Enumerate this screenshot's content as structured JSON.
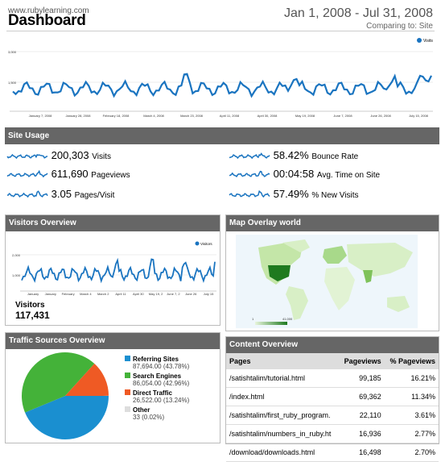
{
  "header": {
    "site": "www.rubylearning.com",
    "title": "Dashboard",
    "date_range": "Jan 1, 2008 - Jul 31, 2008",
    "comparing": "Comparing to: Site"
  },
  "main_chart": {
    "legend": "Visits",
    "y_labels": [
      "3,000",
      "1,500"
    ],
    "x_labels": [
      "January 7, 2008",
      "January 28, 2008",
      "February 18, 2008",
      "March 4, 2008",
      "March 23, 2008",
      "April 11, 2008",
      "April 30, 2008",
      "May 19, 2008",
      "June 7, 2008",
      "June 26, 2008",
      "July 15, 2008"
    ]
  },
  "site_usage": {
    "heading": "Site Usage",
    "metrics": [
      {
        "value": "200,303",
        "label": "Visits"
      },
      {
        "value": "58.42%",
        "label": "Bounce Rate"
      },
      {
        "value": "611,690",
        "label": "Pageviews"
      },
      {
        "value": "00:04:58",
        "label": "Avg. Time on Site"
      },
      {
        "value": "3.05",
        "label": "Pages/Visit"
      },
      {
        "value": "57.49%",
        "label": "% New Visits"
      }
    ]
  },
  "visitors_overview": {
    "heading": "Visitors Overview",
    "legend": "Visitors",
    "y_labels": [
      "2,000",
      "1,000"
    ],
    "x_labels": [
      "January",
      "January",
      "February",
      "March 4",
      "March 2",
      "April 11",
      "April 30",
      "May 19, 2",
      "June 7, 2",
      "June 26",
      "July 15"
    ],
    "visitors_label": "Visitors",
    "visitors_value": "117,431"
  },
  "map_overlay": {
    "heading": "Map Overlay world",
    "scale_min": "1",
    "scale_max": "41,000"
  },
  "traffic_sources": {
    "heading": "Traffic Sources Overview",
    "items": [
      {
        "name": "Referring Sites",
        "detail": "87,694.00 (43.78%)",
        "color": "#1a8fd0",
        "pct": 43.78
      },
      {
        "name": "Search Engines",
        "detail": "86,054.00 (42.96%)",
        "color": "#44b239",
        "pct": 42.96
      },
      {
        "name": "Direct Traffic",
        "detail": "26,522.00 (13.24%)",
        "color": "#ef5a24",
        "pct": 13.24
      },
      {
        "name": "Other",
        "detail": "33 (0.02%)",
        "color": "#dddddd",
        "pct": 0.02
      }
    ]
  },
  "content_overview": {
    "heading": "Content Overview",
    "columns": [
      "Pages",
      "Pageviews",
      "% Pageviews"
    ],
    "rows": [
      {
        "page": "/satishtalim/tutorial.html",
        "views": "99,185",
        "pct": "16.21%"
      },
      {
        "page": "/index.html",
        "views": "69,362",
        "pct": "11.34%"
      },
      {
        "page": "/satishtalim/first_ruby_program.",
        "views": "22,110",
        "pct": "3.61%"
      },
      {
        "page": "/satishtalim/numbers_in_ruby.ht",
        "views": "16,936",
        "pct": "2.77%"
      },
      {
        "page": "/download/downloads.html",
        "views": "16,498",
        "pct": "2.70%"
      }
    ]
  },
  "colors": {
    "line": "#1a74c0",
    "header_bar": "#666666"
  }
}
